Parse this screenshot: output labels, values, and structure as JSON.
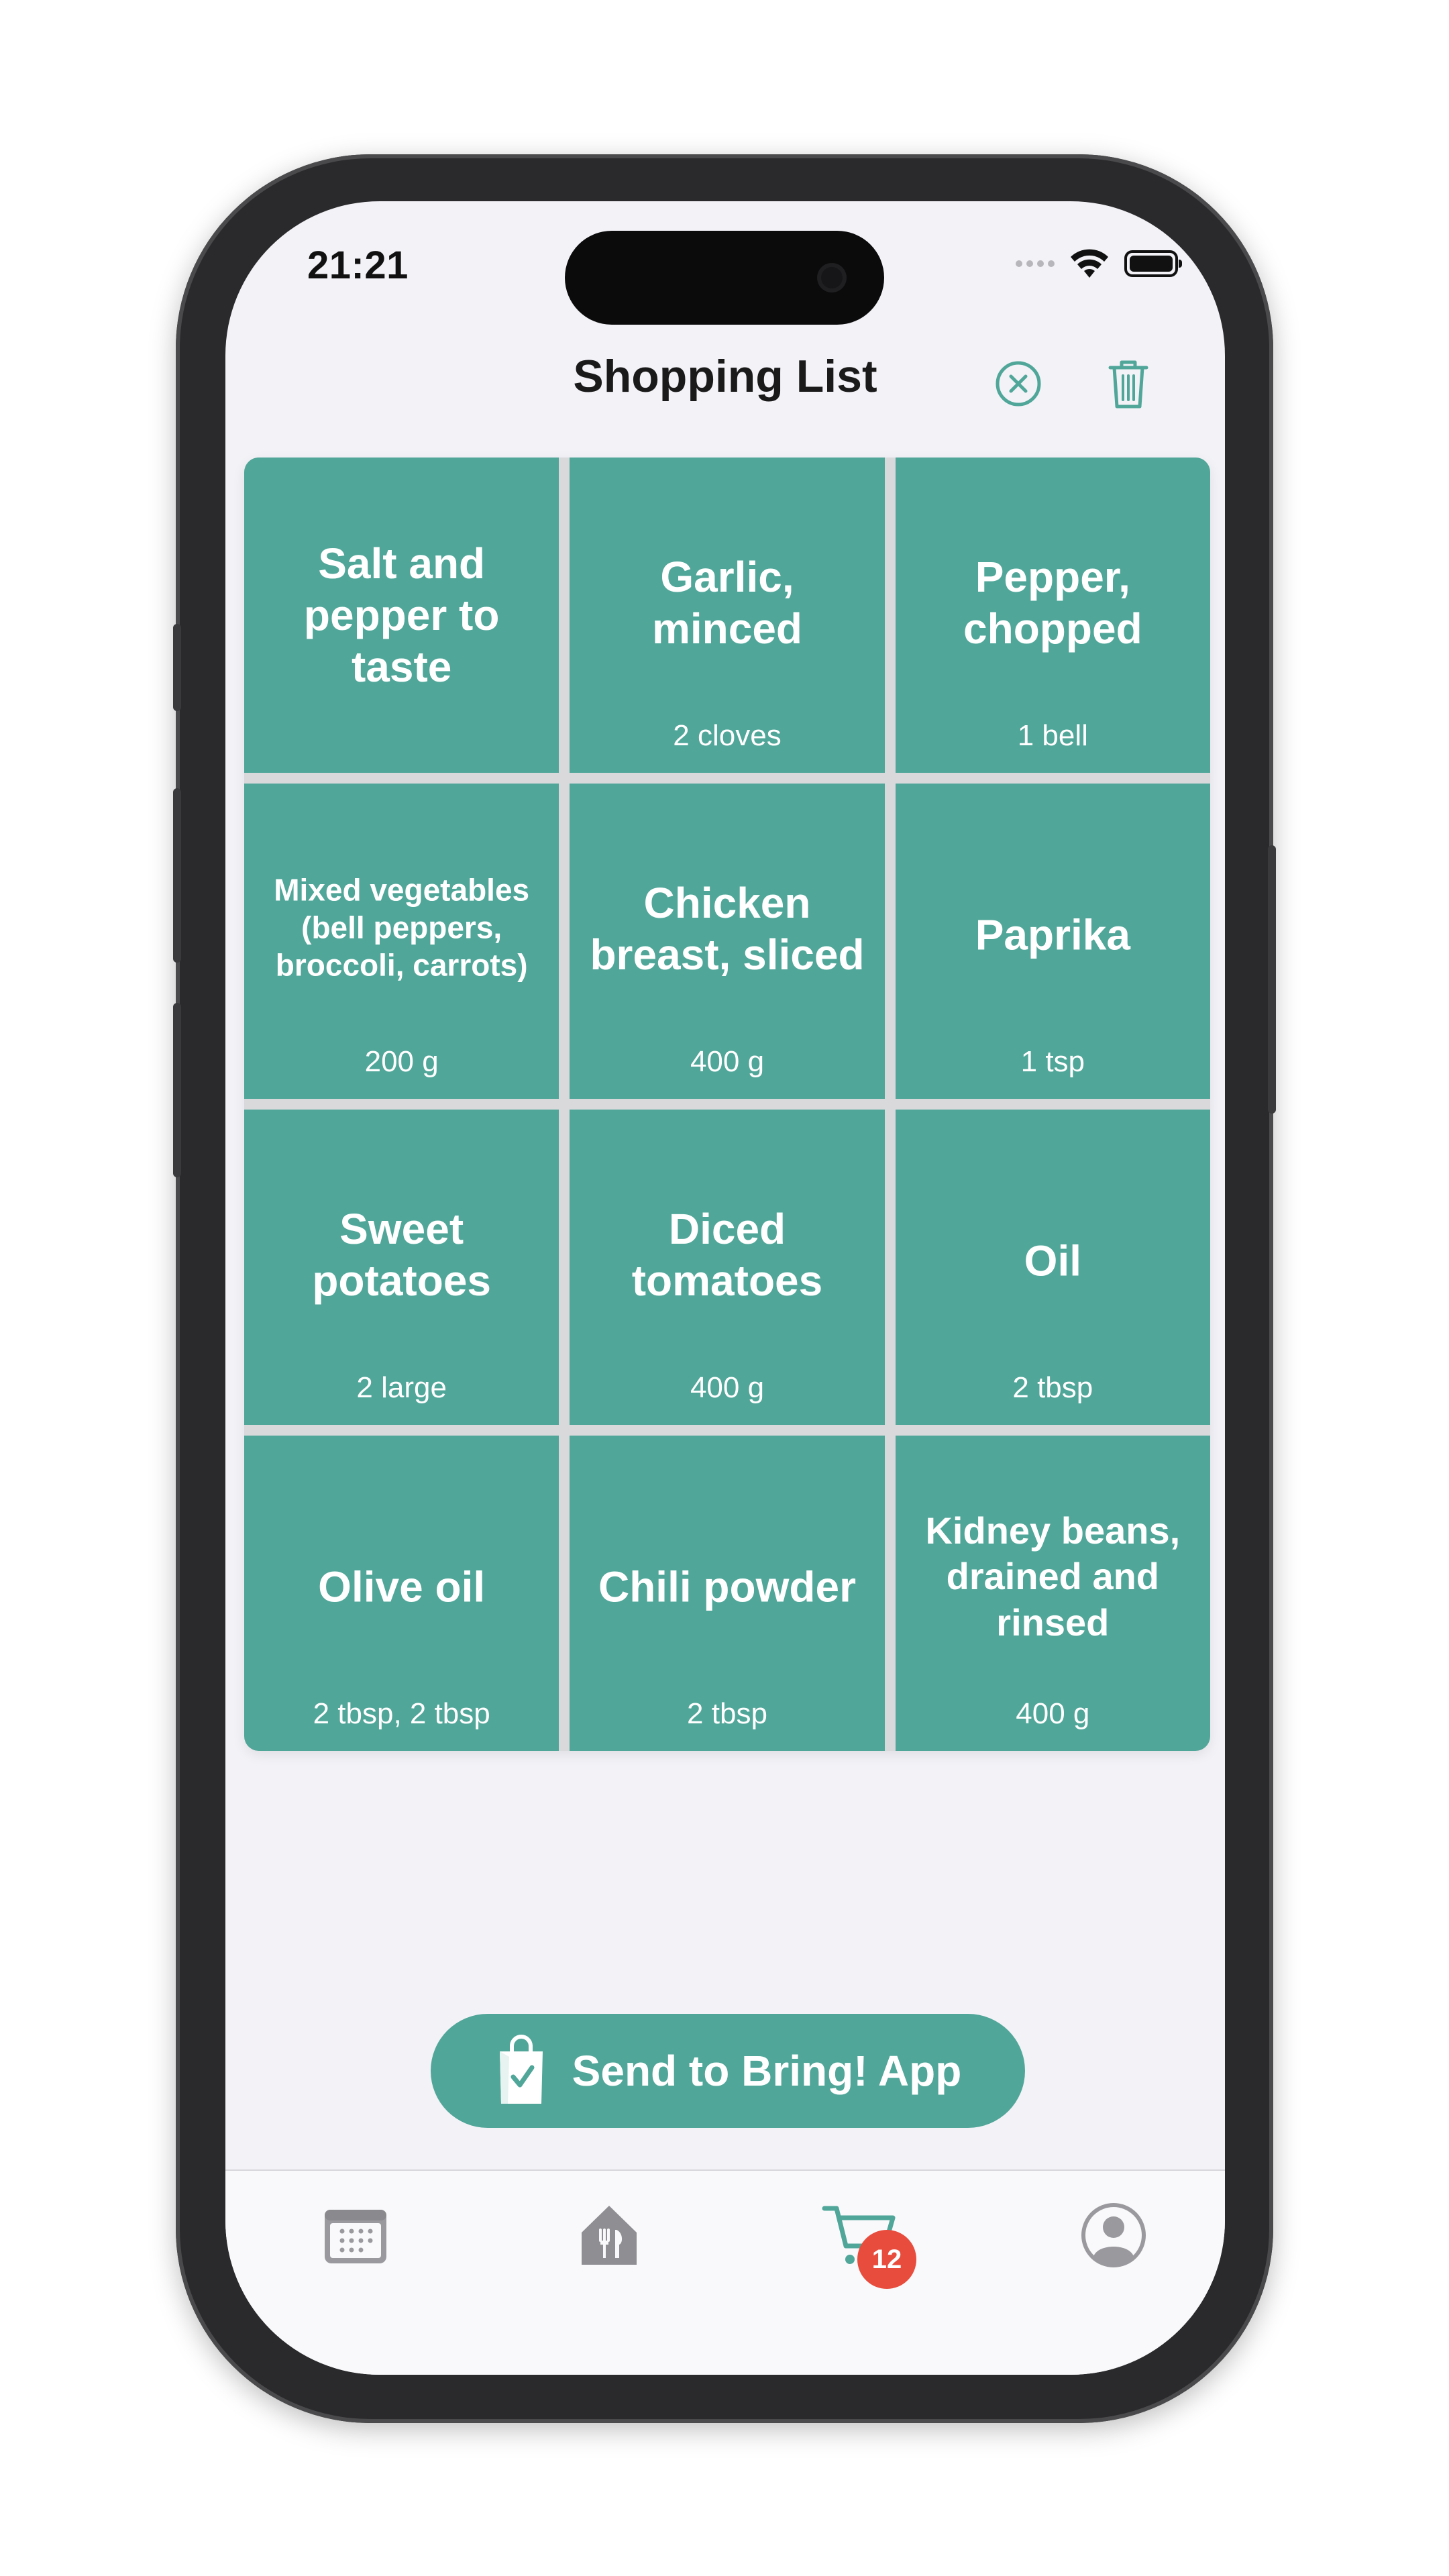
{
  "status_bar": {
    "time": "21:21"
  },
  "nav": {
    "title": "Shopping List"
  },
  "items": [
    {
      "name": "Salt and pepper to taste",
      "qty": ""
    },
    {
      "name": "Garlic, minced",
      "qty": "2 cloves"
    },
    {
      "name": "Pepper, chopped",
      "qty": "1 bell"
    },
    {
      "name": "Mixed vegetables (bell peppers, broccoli, carrots)",
      "qty": "200 g"
    },
    {
      "name": "Chicken breast, sliced",
      "qty": "400 g"
    },
    {
      "name": "Paprika",
      "qty": "1 tsp"
    },
    {
      "name": "Sweet potatoes",
      "qty": "2 large"
    },
    {
      "name": "Diced tomatoes",
      "qty": "400 g"
    },
    {
      "name": "Oil",
      "qty": "2 tbsp"
    },
    {
      "name": "Olive oil",
      "qty": "2 tbsp, 2 tbsp"
    },
    {
      "name": "Chili powder",
      "qty": "2 tbsp"
    },
    {
      "name": "Kidney beans, drained and rinsed",
      "qty": "400 g"
    }
  ],
  "bring_button": {
    "label": "Send to Bring! App"
  },
  "tabbar": {
    "cart_badge": "12",
    "tabs": [
      "calendar-icon",
      "restaurant-icon",
      "cart-icon",
      "profile-icon"
    ]
  },
  "colors": {
    "accent": "#50a699",
    "badge": "#e84c3d",
    "background": "#f2f2f7"
  }
}
